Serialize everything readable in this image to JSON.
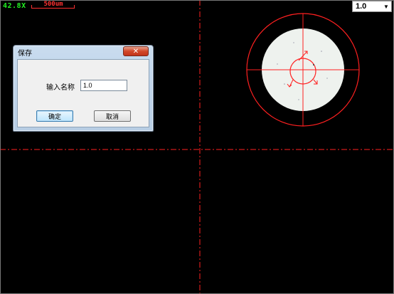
{
  "overlay": {
    "zoom_readout": "42.8X",
    "scale_bar_label": "500um",
    "zoom_select_value": "1.0",
    "crosshair_color": "#ff2020",
    "readout_color": "#22ee22"
  },
  "dialog": {
    "title": "保存",
    "close_glyph": "✕",
    "name_label": "输入名称",
    "name_value": "1.0",
    "ok_label": "确定",
    "cancel_label": "取消"
  },
  "icons": {
    "dropdown_arrow": "chevron-down-icon",
    "close": "close-icon"
  }
}
